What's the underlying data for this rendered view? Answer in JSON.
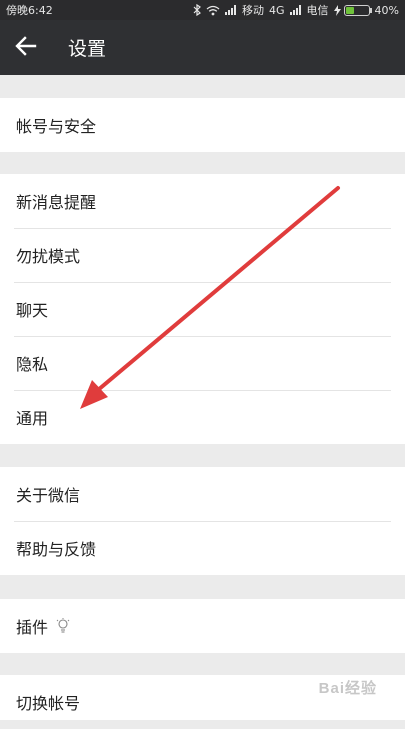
{
  "status_bar": {
    "time_label": "傍晚6:42",
    "carrier1": "移动",
    "network": "4G",
    "carrier2": "电信",
    "battery": "40%",
    "battery_level": 0.4
  },
  "header": {
    "title": "设置"
  },
  "groups": {
    "account": [
      "帐号与安全"
    ],
    "main": [
      "新消息提醒",
      "勿扰模式",
      "聊天",
      "隐私",
      "通用"
    ],
    "about": [
      "关于微信",
      "帮助与反馈"
    ],
    "plugins": [
      "插件"
    ],
    "switch": [
      "切换帐号"
    ]
  },
  "watermark": "Bai经验",
  "colors": {
    "header_bg": "#2f3033",
    "status_bg": "#2b2b2d",
    "arrow": "#e03c3c",
    "page_bg": "#ebebeb"
  },
  "icons": {
    "back": "arrow-left-icon",
    "plugin": "lightbulb-icon"
  }
}
